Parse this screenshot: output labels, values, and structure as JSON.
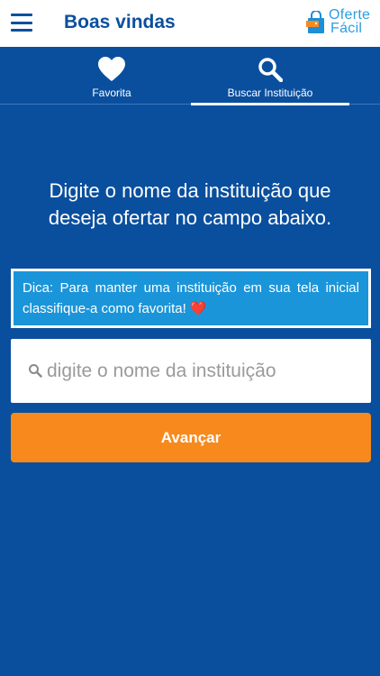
{
  "appbar": {
    "title": "Boas vindas",
    "logo_line1": "Oferte",
    "logo_line2": "Fácil"
  },
  "tabs": [
    {
      "label": "Favorita",
      "icon": "heart-icon",
      "active": false
    },
    {
      "label": "Buscar Instituição",
      "icon": "search-icon",
      "active": true
    }
  ],
  "main": {
    "instruction": "Digite o nome da instituição que deseja ofertar no campo abaixo.",
    "tip": "Dica: Para manter uma instituição em sua tela inicial classifique-a como favorita!",
    "tip_emoji": "❤️",
    "search_placeholder": "digite o nome da instituição",
    "search_value": "",
    "next_label": "Avançar"
  },
  "colors": {
    "primary": "#0a4f9e",
    "tip_background": "#1b95d9",
    "button": "#f7891d",
    "logo": "#2e9de0"
  }
}
